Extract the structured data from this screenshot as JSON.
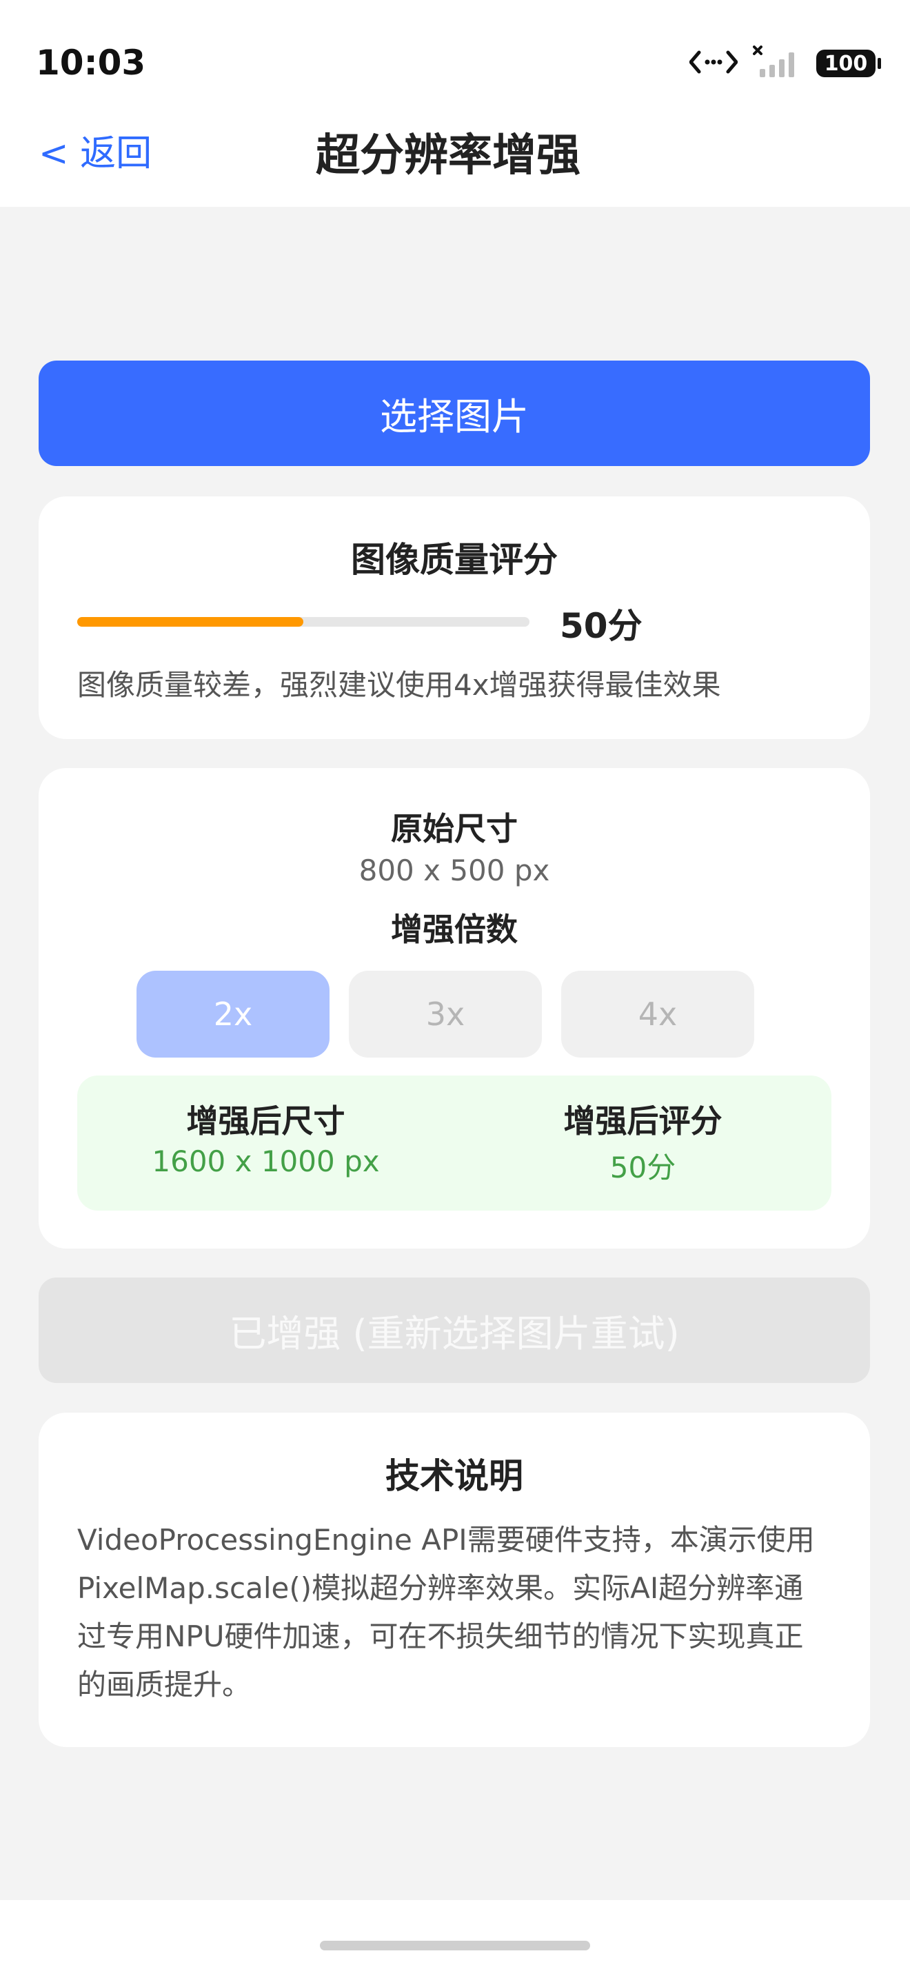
{
  "status_bar": {
    "time": "10:03",
    "battery": "100"
  },
  "nav": {
    "back_label": "< 返回",
    "title": "超分辨率增强"
  },
  "select_button": {
    "label": "选择图片",
    "color": "#386cff"
  },
  "quality": {
    "title": "图像质量评分",
    "score_value": 50,
    "score_max": 100,
    "score_label": "50分",
    "description": "图像质量较差，强烈建议使用4x增强获得最佳效果",
    "bar_color": "#ff9800"
  },
  "size_card": {
    "original_label": "原始尺寸",
    "original_value": "800 x 500 px",
    "scale_label": "增强倍数",
    "scales": [
      "2x",
      "3x",
      "4x"
    ],
    "selected_scale": "2x",
    "enhanced_size_label": "增强后尺寸",
    "enhanced_size_value": "1600 x 1000 px",
    "enhanced_score_label": "增强后评分",
    "enhanced_score_value": "50分",
    "value_color": "#43a047"
  },
  "enhance_button": {
    "label": "已增强 (重新选择图片重试)",
    "disabled": true
  },
  "tech": {
    "title": "技术说明",
    "body": "VideoProcessingEngine API需要硬件支持，本演示使用PixelMap.scale()模拟超分辨率效果。实际AI超分辨率通过专用NPU硬件加速，可在不损失细节的情况下实现真正的画质提升。"
  }
}
